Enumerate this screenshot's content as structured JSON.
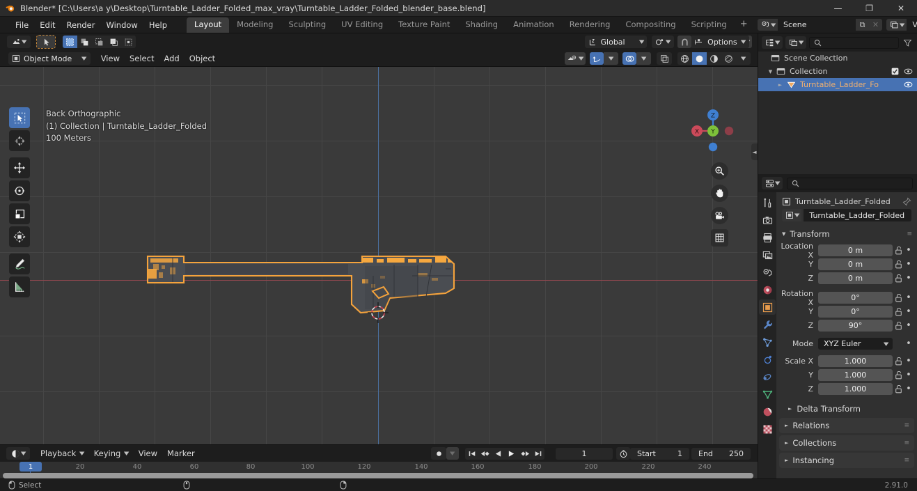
{
  "window": {
    "title": "Blender* [C:\\Users\\a y\\Desktop\\Turntable_Ladder_Folded_max_vray\\Turntable_Ladder_Folded_blender_base.blend]",
    "minimize": "—",
    "maximize": "❐",
    "close": "✕"
  },
  "topbar": {
    "menus": [
      "File",
      "Edit",
      "Render",
      "Window",
      "Help"
    ],
    "workspaces": [
      {
        "label": "Layout",
        "active": true
      },
      {
        "label": "Modeling",
        "active": false
      },
      {
        "label": "Sculpting",
        "active": false
      },
      {
        "label": "UV Editing",
        "active": false
      },
      {
        "label": "Texture Paint",
        "active": false
      },
      {
        "label": "Shading",
        "active": false
      },
      {
        "label": "Animation",
        "active": false
      },
      {
        "label": "Rendering",
        "active": false
      },
      {
        "label": "Compositing",
        "active": false
      },
      {
        "label": "Scripting",
        "active": false
      }
    ],
    "add_workspace": "+",
    "scene_name": "Scene",
    "view_layer_name": "View Layer",
    "new_copy_label": "⧉",
    "unlink_label": "✕"
  },
  "viewport": {
    "mode": "Object Mode",
    "menus": [
      "View",
      "Select",
      "Add",
      "Object"
    ],
    "orientation": "Global",
    "options_label": "Options",
    "overlay_text": {
      "view_name": "Back Orthographic",
      "collection_object": "(1) Collection | Turntable_Ladder_Folded",
      "grid_scale": "100 Meters"
    },
    "gizmo_axes": {
      "x": "X",
      "y": "Y",
      "z": "Z"
    },
    "tools": [
      {
        "name": "tweak-select-tool",
        "active": true
      },
      {
        "name": "cursor-tool",
        "active": false
      },
      {
        "name": "move-tool",
        "active": false
      },
      {
        "name": "rotate-tool",
        "active": false
      },
      {
        "name": "scale-tool",
        "active": false
      },
      {
        "name": "transform-tool",
        "active": false
      },
      {
        "name": "annotate-tool",
        "active": false
      },
      {
        "name": "measure-tool",
        "active": false
      }
    ],
    "nav_buttons": [
      "zoom-icon",
      "pan-hand-icon",
      "camera-icon",
      "grid-ortho-icon"
    ]
  },
  "outliner": {
    "search_placeholder": "",
    "rows": [
      {
        "label": "Scene Collection",
        "indent": 0,
        "icon": "collection-icon",
        "selected": false,
        "has_disclosure": false,
        "checkbox": false,
        "eye": false
      },
      {
        "label": "Collection",
        "indent": 1,
        "icon": "collection-icon",
        "selected": false,
        "has_disclosure": true,
        "checkbox": true,
        "eye": true
      },
      {
        "label": "Turntable_Ladder_Fo",
        "indent": 2,
        "icon": "mesh-object-icon",
        "selected": true,
        "has_disclosure": true,
        "checkbox": false,
        "eye": true
      }
    ]
  },
  "properties": {
    "search_placeholder": "",
    "breadcrumb_object": "Turntable_Ladder_Folded",
    "object_name_value": "Turntable_Ladder_Folded",
    "tabs": [
      {
        "name": "tool-tab",
        "active": false
      },
      {
        "name": "render-tab",
        "active": false
      },
      {
        "name": "output-tab",
        "active": false
      },
      {
        "name": "view-layer-tab",
        "active": false
      },
      {
        "name": "scene-tab",
        "active": false
      },
      {
        "name": "world-tab",
        "active": false
      },
      {
        "name": "object-tab",
        "active": true
      },
      {
        "name": "modifier-tab",
        "active": false
      },
      {
        "name": "particles-tab",
        "active": false
      },
      {
        "name": "physics-tab",
        "active": false
      },
      {
        "name": "constraints-tab",
        "active": false
      },
      {
        "name": "object-data-tab",
        "active": false
      },
      {
        "name": "material-tab",
        "active": false
      },
      {
        "name": "texture-tab",
        "active": false
      }
    ],
    "transform": {
      "title": "Transform",
      "location": {
        "label_x": "Location X",
        "label_y": "Y",
        "label_z": "Z",
        "x": "0 m",
        "y": "0 m",
        "z": "0 m"
      },
      "rotation": {
        "label_x": "Rotation X",
        "label_y": "Y",
        "label_z": "Z",
        "x": "0°",
        "y": "0°",
        "z": "90°"
      },
      "mode": {
        "label": "Mode",
        "value": "XYZ Euler"
      },
      "scale": {
        "label_x": "Scale X",
        "label_y": "Y",
        "label_z": "Z",
        "x": "1.000",
        "y": "1.000",
        "z": "1.000"
      },
      "delta_transform": "Delta Transform"
    },
    "panels": [
      "Relations",
      "Collections",
      "Instancing"
    ]
  },
  "timeline": {
    "menus": [
      "Playback",
      "Keying",
      "View",
      "Marker"
    ],
    "current_frame": "1",
    "start_label": "Start",
    "start_value": "1",
    "end_label": "End",
    "end_value": "250",
    "playhead_frame": "1",
    "ticks": [
      20,
      40,
      60,
      80,
      100,
      120,
      140,
      160,
      180,
      200,
      220,
      240
    ],
    "transport": [
      "jump-start-icon",
      "prev-keyframe-icon",
      "play-reverse-icon",
      "play-icon",
      "next-keyframe-icon",
      "jump-end-icon"
    ],
    "record_icon": "record-icon"
  },
  "statusbar": {
    "select_label": "Select",
    "version": "2.91.0"
  },
  "colors": {
    "accent_blue": "#4772b3",
    "selection_orange": "#f5a33c",
    "mesh_grey": "#4a4d52",
    "panel_bg": "#303030",
    "header_bg": "#1d1d1d"
  }
}
